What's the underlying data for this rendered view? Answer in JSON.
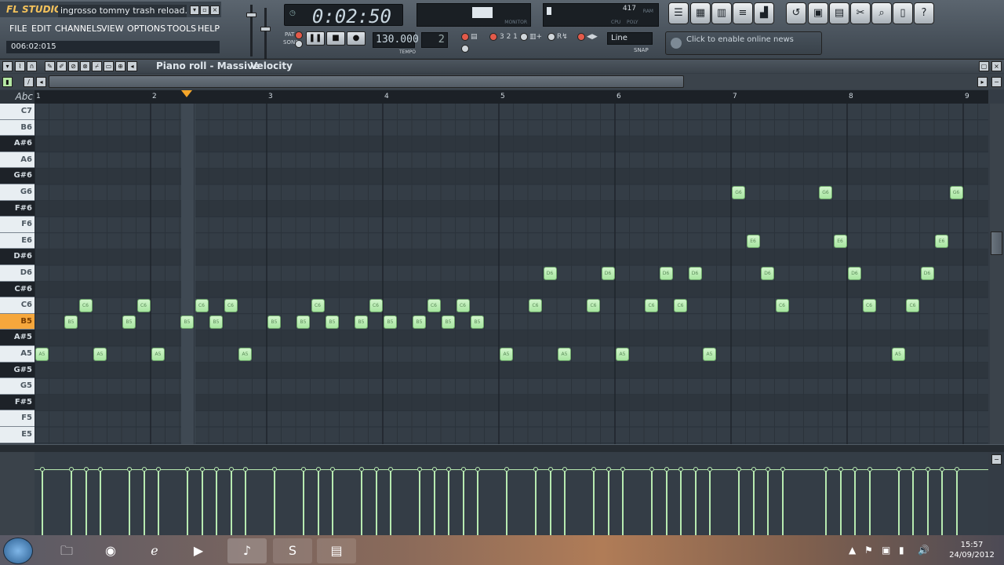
{
  "app": {
    "logo": "FL STUDIO",
    "window_title": "ingrosso tommy trash reload...",
    "hint": "006:02:015"
  },
  "menu": [
    "FILE",
    "EDIT",
    "CHANNELS",
    "VIEW",
    "OPTIONS",
    "TOOLS",
    "HELP"
  ],
  "transport": {
    "time": "0:02:50",
    "tempo": "130.000",
    "pattern": "2",
    "pat_label": "PAT",
    "song_label": "SONG",
    "tempo_label": "TEMPO",
    "line_mode": "Line",
    "snap_label": "SNAP",
    "monitor_label": "MONITOR",
    "cpu_label": "CPU",
    "poly_label": "POLY",
    "ram_label": "RAM",
    "cpu_values": "417"
  },
  "news": "Click to enable online news",
  "piano_roll": {
    "title": "Piano roll - Massive",
    "target": "Velocity",
    "abc": "Abc",
    "bars": [
      "1",
      "2",
      "3",
      "4",
      "5",
      "6",
      "7",
      "8",
      "9"
    ],
    "keys": [
      "C7",
      "B6",
      "A#6",
      "A6",
      "G#6",
      "G6",
      "F#6",
      "F6",
      "E6",
      "D#6",
      "D6",
      "C#6",
      "C6",
      "B5",
      "A#5",
      "A5",
      "G#5",
      "G5",
      "F#5",
      "F5",
      "E5"
    ],
    "highlighted_key": "B5",
    "notes": [
      {
        "label": "A5",
        "step": 0
      },
      {
        "label": "B5",
        "step": 2
      },
      {
        "label": "C6",
        "step": 3
      },
      {
        "label": "A5",
        "step": 4
      },
      {
        "label": "B5",
        "step": 6
      },
      {
        "label": "C6",
        "step": 7
      },
      {
        "label": "A5",
        "step": 8
      },
      {
        "label": "B5",
        "step": 10
      },
      {
        "label": "C6",
        "step": 11
      },
      {
        "label": "B5",
        "step": 12
      },
      {
        "label": "C6",
        "step": 13
      },
      {
        "label": "A5",
        "step": 14
      },
      {
        "label": "B5",
        "step": 16
      },
      {
        "label": "B5",
        "step": 18
      },
      {
        "label": "C6",
        "step": 19
      },
      {
        "label": "B5",
        "step": 20
      },
      {
        "label": "B5",
        "step": 22
      },
      {
        "label": "C6",
        "step": 23
      },
      {
        "label": "B5",
        "step": 24
      },
      {
        "label": "B5",
        "step": 26
      },
      {
        "label": "C6",
        "step": 27
      },
      {
        "label": "B5",
        "step": 28
      },
      {
        "label": "C6",
        "step": 29
      },
      {
        "label": "B5",
        "step": 30
      },
      {
        "label": "A5",
        "step": 32
      },
      {
        "label": "C6",
        "step": 34
      },
      {
        "label": "D6",
        "step": 35
      },
      {
        "label": "A5",
        "step": 36
      },
      {
        "label": "C6",
        "step": 38
      },
      {
        "label": "D6",
        "step": 39
      },
      {
        "label": "A5",
        "step": 40
      },
      {
        "label": "C6",
        "step": 42
      },
      {
        "label": "D6",
        "step": 43
      },
      {
        "label": "C6",
        "step": 44
      },
      {
        "label": "D6",
        "step": 45
      },
      {
        "label": "A5",
        "step": 46
      },
      {
        "label": "G6",
        "step": 48
      },
      {
        "label": "E6",
        "step": 49
      },
      {
        "label": "D6",
        "step": 50
      },
      {
        "label": "C6",
        "step": 51
      },
      {
        "label": "G6",
        "step": 54
      },
      {
        "label": "E6",
        "step": 55
      },
      {
        "label": "D6",
        "step": 56
      },
      {
        "label": "C6",
        "step": 57
      },
      {
        "label": "A5",
        "step": 59
      },
      {
        "label": "C6",
        "step": 60
      },
      {
        "label": "D6",
        "step": 61
      },
      {
        "label": "E6",
        "step": 62
      },
      {
        "label": "G6",
        "step": 63
      }
    ]
  },
  "taskbar": {
    "time": "15:57",
    "date": "24/09/2012"
  },
  "colors": {
    "note": "#b9efb2",
    "highlight_key": "#f6a73c",
    "grid_bg": "#343d46",
    "playhead": "#f4a62a"
  }
}
